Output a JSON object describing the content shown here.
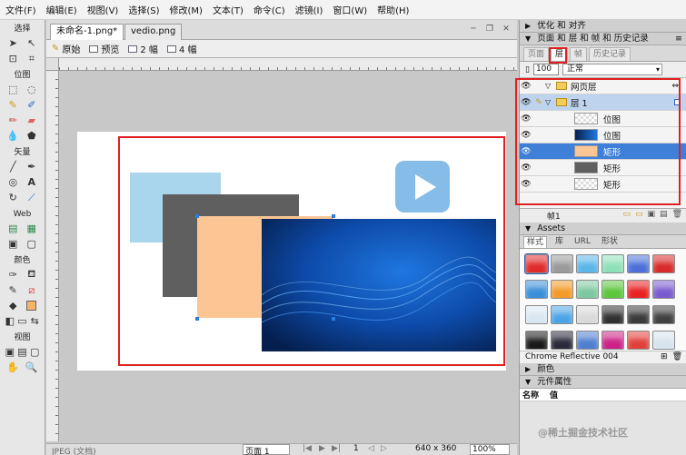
{
  "menu": [
    "文件(F)",
    "编辑(E)",
    "视图(V)",
    "选择(S)",
    "修改(M)",
    "文本(T)",
    "命令(C)",
    "滤镜(I)",
    "窗口(W)",
    "帮助(H)"
  ],
  "tools": {
    "sections": {
      "select": "选择",
      "bitmap": "位图",
      "vector": "矢量",
      "web": "Web",
      "colors": "颜色",
      "view": "视图"
    }
  },
  "document": {
    "tabs": [
      "未命名-1.png*",
      "vedio.png"
    ],
    "view_buttons": [
      "原始",
      "预览",
      "2 幅",
      "4 幅"
    ],
    "status": {
      "file_type": "JPEG (文档)",
      "page": "页面 1",
      "frame": "1",
      "size": "640 x 360",
      "zoom": "100%"
    }
  },
  "panels": {
    "optimize": "优化 和 对齐",
    "layers_panel": "页面 和 层 和 帧 和 历史记录",
    "layer_tabs": [
      "页面",
      "层",
      "帧",
      "历史记录"
    ],
    "opacity": "100",
    "blend_mode": "正常",
    "layers": [
      {
        "name": "网页层",
        "kind": "folder"
      },
      {
        "name": "层 1",
        "kind": "folder"
      },
      {
        "name": "位图",
        "kind": "bitmap"
      },
      {
        "name": "位图",
        "kind": "bitmap-blue"
      },
      {
        "name": "矩形",
        "kind": "rect-orange"
      },
      {
        "name": "矩形",
        "kind": "rect-gray"
      },
      {
        "name": "矩形",
        "kind": "rect-light"
      }
    ],
    "frames_label": "帧1",
    "assets": "Assets",
    "asset_tabs": [
      "样式",
      "库",
      "URL",
      "形状"
    ],
    "selected_style": "Chrome Reflective 004",
    "colors": "颜色",
    "properties": "元件属性",
    "prop_columns": [
      "名称",
      "值"
    ],
    "watermark": "@稀土掘金技术社区"
  },
  "colors": {
    "light_blue_rect": "#a9d6ec",
    "gray_rect": "#5f5f5f",
    "orange_rect": "#fbc594",
    "play_button": "#86bde8",
    "selection_red": "#e02020",
    "layer_selected": "#3e7fd8"
  }
}
